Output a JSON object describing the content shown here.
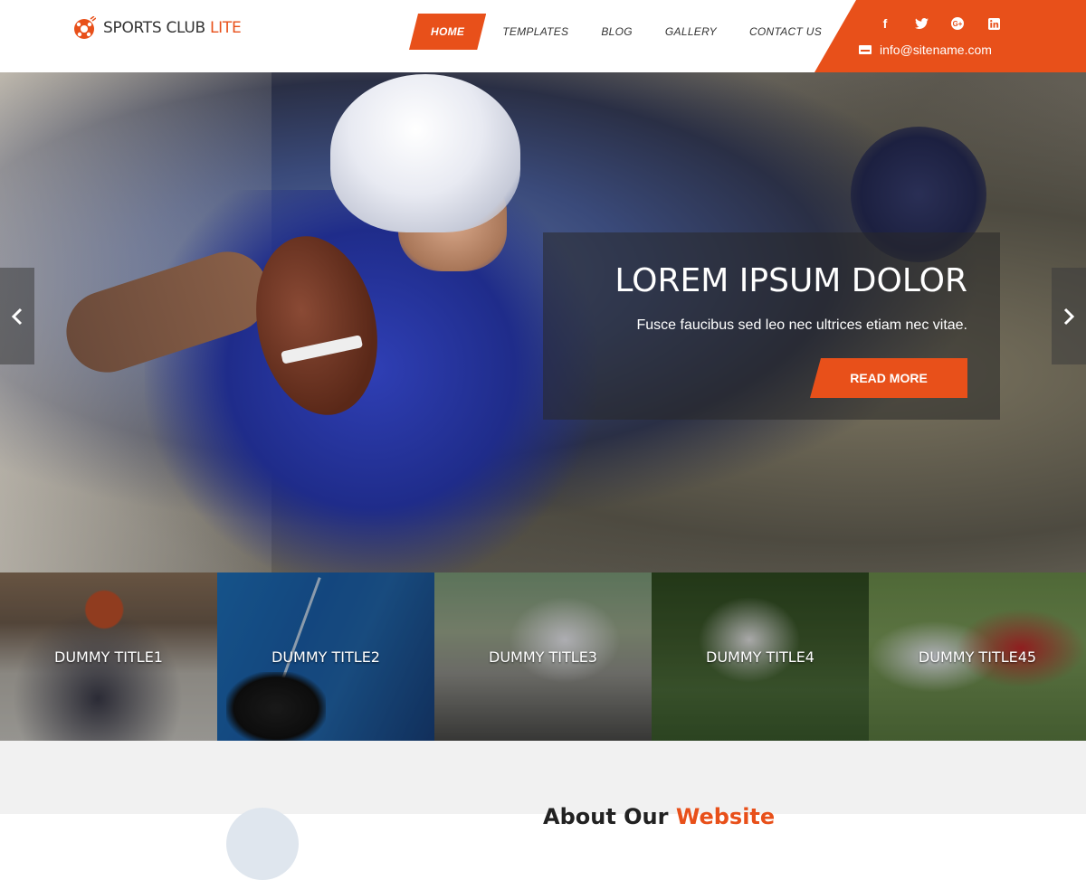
{
  "brand": {
    "logo_main": "SPORTS CLUB",
    "logo_accent": "LITE",
    "accent_color": "#e8501a"
  },
  "nav": {
    "items": [
      {
        "label": "HOME",
        "active": true
      },
      {
        "label": "TEMPLATES",
        "active": false
      },
      {
        "label": "BLOG",
        "active": false
      },
      {
        "label": "GALLERY",
        "active": false
      },
      {
        "label": "CONTACT US",
        "active": false
      }
    ]
  },
  "contact": {
    "social_icons": [
      "facebook-icon",
      "twitter-icon",
      "google-plus-icon",
      "linkedin-icon"
    ],
    "social_glyphs": [
      "f",
      "t",
      "G+",
      "in"
    ],
    "email": "info@sitename.com"
  },
  "hero": {
    "title": "LOREM IPSUM DOLOR",
    "subtitle": "Fusce faucibus sed leo nec ultrices etiam nec vitae.",
    "button_label": "READ MORE"
  },
  "categories": [
    {
      "title": "DUMMY TITLE1"
    },
    {
      "title": "DUMMY TITLE2"
    },
    {
      "title": "DUMMY TITLE3"
    },
    {
      "title": "DUMMY TITLE4"
    },
    {
      "title": "DUMMY TITLE45"
    }
  ],
  "about": {
    "title_part1": "About Our",
    "title_part2": "Website"
  }
}
